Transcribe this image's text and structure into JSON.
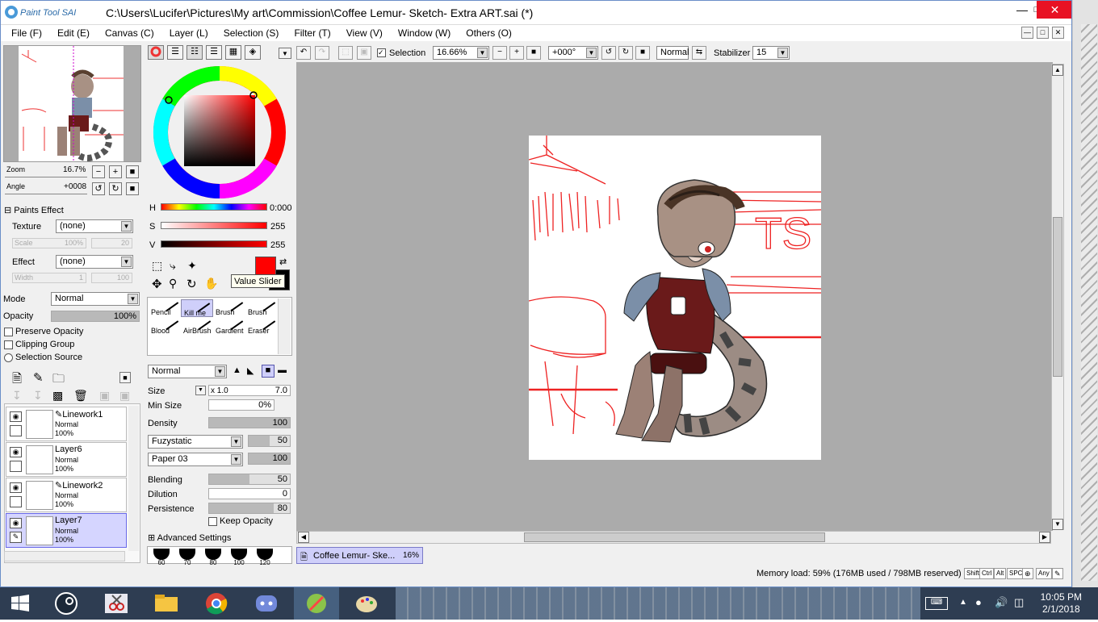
{
  "app": {
    "logo_text": "Paint Tool SAI",
    "title": "C:\\Users\\Lucifer\\Pictures\\My art\\Commission\\Coffee Lemur- Sketch- Extra ART.sai (*)"
  },
  "menu": [
    "File (F)",
    "Edit (E)",
    "Canvas (C)",
    "Layer (L)",
    "Selection (S)",
    "Filter (T)",
    "View (V)",
    "Window (W)",
    "Others (O)"
  ],
  "navigator": {
    "zoom_label": "Zoom",
    "zoom_value": "16.7%",
    "angle_label": "Angle",
    "angle_value": "+0008"
  },
  "paints_effect": {
    "header": "Paints Effect",
    "texture_label": "Texture",
    "texture_value": "(none)",
    "scale_label": "Scale",
    "scale_value": "100%",
    "scale_num": "20",
    "effect_label": "Effect",
    "effect_value": "(none)",
    "width_label": "Width",
    "width_value": "1",
    "width_num": "100"
  },
  "layer_props": {
    "mode_label": "Mode",
    "mode_value": "Normal",
    "opacity_label": "Opacity",
    "opacity_value": "100%",
    "preserve_opacity": "Preserve Opacity",
    "clipping_group": "Clipping Group",
    "selection_source": "Selection Source"
  },
  "layers": [
    {
      "name": "Linework1",
      "mode": "Normal",
      "opacity": "100%",
      "kind": "linework",
      "selected": false
    },
    {
      "name": "Layer6",
      "mode": "Normal",
      "opacity": "100%",
      "kind": "layer",
      "selected": false
    },
    {
      "name": "Linework2",
      "mode": "Normal",
      "opacity": "100%",
      "kind": "linework",
      "selected": false
    },
    {
      "name": "Layer7",
      "mode": "Normal",
      "opacity": "100%",
      "kind": "layer",
      "selected": true
    }
  ],
  "color": {
    "h_label": "H",
    "h_value": "0:000",
    "s_label": "S",
    "s_value": "255",
    "v_label": "V",
    "v_value": "255",
    "primary": "#ff0000",
    "secondary": "#000000",
    "tooltip": "Value Slider"
  },
  "tools": [
    {
      "label": "Pencil"
    },
    {
      "label": "Kill me"
    },
    {
      "label": "Brush"
    },
    {
      "label": "Brush"
    },
    {
      "label": "Blood"
    },
    {
      "label": "AirBrush"
    },
    {
      "label": "Gardient"
    },
    {
      "label": "Eraser"
    }
  ],
  "brush": {
    "blend_mode": "Normal",
    "size_label": "Size",
    "size_mult": "x 1.0",
    "size_value": "7.0",
    "min_size_label": "Min Size",
    "min_size_value": "0%",
    "density_label": "Density",
    "density_value": "100",
    "texture1": "Fuzystatic",
    "texture1_value": "50",
    "texture2": "Paper 03",
    "texture2_value": "100",
    "blending_label": "Blending",
    "blending_value": "50",
    "dilution_label": "Dilution",
    "dilution_value": "0",
    "persistence_label": "Persistence",
    "persistence_value": "80",
    "keep_opacity": "Keep Opacity",
    "advanced": "Advanced Settings",
    "dot_sizes": [
      "60",
      "70",
      "80",
      "100",
      "120"
    ]
  },
  "toolbar": {
    "selection_label": "Selection",
    "zoom_value": "16.66%",
    "rotation_value": "+000°",
    "blend_value": "Normal",
    "stabilizer_label": "Stabilizer",
    "stabilizer_value": "15"
  },
  "doc_tab": {
    "name": "Coffee Lemur- Ske...",
    "zoom": "16%"
  },
  "status": {
    "memory": "Memory load: 59% (176MB used / 798MB reserved)",
    "keys": [
      "Shift",
      "Ctrl",
      "Alt",
      "SPC",
      "Any"
    ]
  },
  "taskbar": {
    "time": "10:05 PM",
    "date": "2/1/2018"
  }
}
